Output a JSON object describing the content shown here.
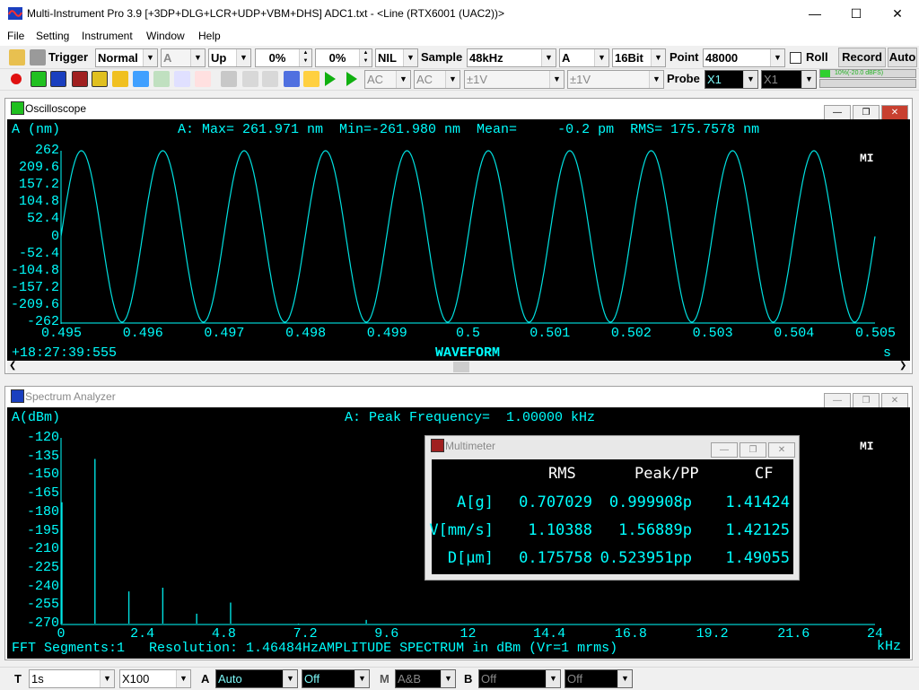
{
  "app": {
    "title": "Multi-Instrument Pro 3.9    [+3DP+DLG+LCR+UDP+VBM+DHS]    ADC1.txt   -  <Line (RTX6001 (UAC2))>",
    "window_controls": [
      "minimize-icon",
      "maximize-icon",
      "close-icon"
    ]
  },
  "menu": [
    "File",
    "Setting",
    "Instrument",
    "Window",
    "Help"
  ],
  "toolbar1": {
    "trigger_label": "Trigger",
    "trigger_mode": "Normal",
    "trigger_channel": "A",
    "trigger_edge": "Up",
    "trigger_level": "0%",
    "trigger_delay": "0%",
    "window_func": "NIL",
    "sample_label": "Sample",
    "sample_rate": "48kHz",
    "channel": "A",
    "bits": "16Bit",
    "point_label": "Point",
    "points": "48000",
    "roll_label": "Roll",
    "record_label": "Record",
    "auto_label": "Auto"
  },
  "toolbar2": {
    "coupling_a": "AC",
    "coupling_b": "AC",
    "range_a": "±1V",
    "range_b": "±1V",
    "probe_label": "Probe",
    "probe_a": "X1",
    "probe_b": "X1",
    "level_text": "10%(-20.0 dBFS)"
  },
  "oscilloscope": {
    "title": "Oscilloscope",
    "unit_label": "A (nm)",
    "stats": "A: Max= 261.971 nm  Min=-261.980 nm  Mean=     -0.2 pm  RMS= 175.7578 nm",
    "y_ticks": [
      "262",
      "209.6",
      "157.2",
      "104.8",
      "52.4",
      "0",
      "-52.4",
      "-104.8",
      "-157.2",
      "-209.6",
      "-262"
    ],
    "x_ticks": [
      "0.495",
      "0.496",
      "0.497",
      "0.498",
      "0.499",
      "0.5",
      "0.501",
      "0.502",
      "0.503",
      "0.504",
      "0.505"
    ],
    "x_unit": "s",
    "timestamp": "+18:27:39:555",
    "mode_label": "WAVEFORM",
    "logo": "MI"
  },
  "spectrum": {
    "title": "Spectrum Analyzer",
    "unit_label": "A(dBm)",
    "peak": "A: Peak Frequency=  1.00000 kHz",
    "y_ticks": [
      "-120",
      "-135",
      "-150",
      "-165",
      "-180",
      "-195",
      "-210",
      "-225",
      "-240",
      "-255",
      "-270"
    ],
    "x_ticks": [
      "0",
      "2.4",
      "4.8",
      "7.2",
      "9.6",
      "12",
      "14.4",
      "16.8",
      "19.2",
      "21.6",
      "24"
    ],
    "x_unit": "kHz",
    "footer": "FFT Segments:1   Resolution: 1.46484HzAMPLITUDE SPECTRUM in dBm (Vr=1 mrms)",
    "logo": "MI"
  },
  "multimeter": {
    "title": "Multimeter",
    "headers": [
      "RMS",
      "Peak/PP",
      "CF"
    ],
    "rows": [
      {
        "label": "A[g]",
        "rms": "0.707029",
        "peak": "0.999908p",
        "cf": "1.41424"
      },
      {
        "label": "V[mm/s]",
        "rms": "1.10388",
        "peak": "1.56889p",
        "cf": "1.42125"
      },
      {
        "label": "D[µm]",
        "rms": "0.175758",
        "peak": "0.523951pp",
        "cf": "1.49055"
      }
    ]
  },
  "statusbar": {
    "t_label": "T",
    "t_value": "1s",
    "zoom": "X100",
    "a_label": "A",
    "a_value": "Auto",
    "a_second": "Off",
    "m_label": "M",
    "m_value": "A&B",
    "b_label": "B",
    "b_value": "Off",
    "b_second": "Off"
  },
  "chart_data": [
    {
      "type": "line",
      "title": "A: Max= 261.971 nm  Min=-261.980 nm  Mean=     -0.2 pm  RMS= 175.7578 nm",
      "xlabel": "s",
      "ylabel": "A (nm)",
      "xlim": [
        0.495,
        0.505
      ],
      "ylim": [
        -262,
        262
      ],
      "series": [
        {
          "name": "A",
          "frequency_hz": 1000,
          "amplitude": 262,
          "phase_at_xmin": 0
        }
      ],
      "grid": false
    },
    {
      "type": "bar",
      "title": "A: Peak Frequency=  1.00000 kHz",
      "xlabel": "kHz",
      "ylabel": "A(dBm)",
      "xlim": [
        0,
        24
      ],
      "ylim": [
        -270,
        -120
      ],
      "x": [
        0,
        1,
        2,
        3,
        4,
        5,
        6,
        7,
        9
      ],
      "values": [
        -172,
        -137,
        -244,
        -241,
        -262,
        -253,
        -270,
        -271,
        -267
      ],
      "grid": false
    }
  ],
  "colors": {
    "trace": "#00e0e0",
    "text": "#00ffff",
    "background": "#000000"
  }
}
